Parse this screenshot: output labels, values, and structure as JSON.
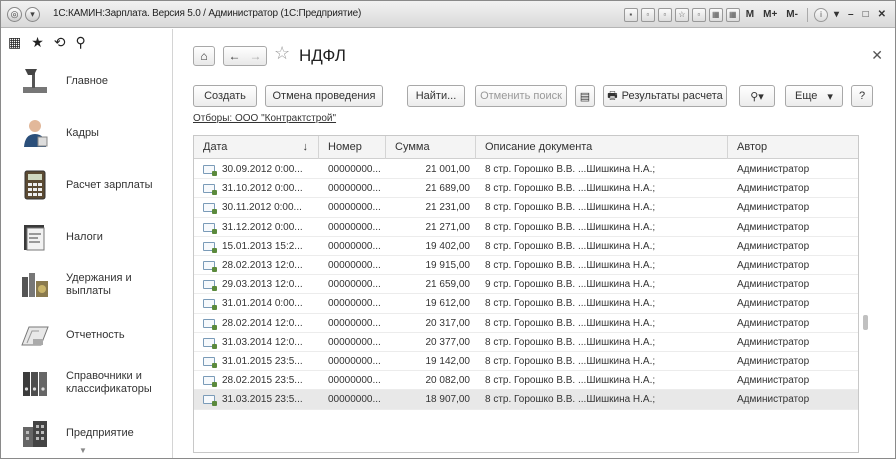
{
  "window": {
    "title": "1С:КАМИН:Зарплата. Версия 5.0 / Администратор (1С:Предприятие)",
    "toolbar_labels": [
      "M",
      "M+",
      "M-"
    ]
  },
  "sidebar": {
    "items": [
      {
        "label": "Главное",
        "icon": "desk-lamp-icon"
      },
      {
        "label": "Кадры",
        "icon": "person-icon"
      },
      {
        "label": "Расчет зарплаты",
        "icon": "calculator-icon"
      },
      {
        "label": "Налоги",
        "icon": "tax-book-icon"
      },
      {
        "label": "Удержания и выплаты",
        "icon": "money-stack-icon"
      },
      {
        "label": "Отчетность",
        "icon": "report-icon"
      },
      {
        "label": "Справочники и классификаторы",
        "icon": "binders-icon"
      },
      {
        "label": "Предприятие",
        "icon": "building-icon"
      }
    ]
  },
  "page": {
    "title": "НДФЛ"
  },
  "toolbar": {
    "create": "Создать",
    "cancel_posting": "Отмена проведения",
    "find": "Найти...",
    "cancel_search": "Отменить поиск",
    "results": "Результаты расчета",
    "more": "Еще",
    "help": "?"
  },
  "filter_text": "Отборы: ООО \"Контрактстрой\"",
  "table": {
    "columns": [
      "Дата",
      "Номер",
      "Сумма",
      "Описание документа",
      "Автор"
    ],
    "sort_indicator": "↓",
    "rows": [
      {
        "date": "30.09.2012 0:00...",
        "number": "00000000...",
        "sum": "21 001,00",
        "desc": "8 стр. Горошко В.В. ...Шишкина Н.А.;",
        "author": "Администратор"
      },
      {
        "date": "31.10.2012 0:00...",
        "number": "00000000...",
        "sum": "21 689,00",
        "desc": "8 стр. Горошко В.В. ...Шишкина Н.А.;",
        "author": "Администратор"
      },
      {
        "date": "30.11.2012 0:00...",
        "number": "00000000...",
        "sum": "21 231,00",
        "desc": "8 стр. Горошко В.В. ...Шишкина Н.А.;",
        "author": "Администратор"
      },
      {
        "date": "31.12.2012 0:00...",
        "number": "00000000...",
        "sum": "21 271,00",
        "desc": "8 стр. Горошко В.В. ...Шишкина Н.А.;",
        "author": "Администратор"
      },
      {
        "date": "15.01.2013 15:2...",
        "number": "00000000...",
        "sum": "19 402,00",
        "desc": "8 стр. Горошко В.В. ...Шишкина Н.А.;",
        "author": "Администратор"
      },
      {
        "date": "28.02.2013 12:0...",
        "number": "00000000...",
        "sum": "19 915,00",
        "desc": "8 стр. Горошко В.В. ...Шишкина Н.А.;",
        "author": "Администратор"
      },
      {
        "date": "29.03.2013 12:0...",
        "number": "00000000...",
        "sum": "21 659,00",
        "desc": "9 стр. Горошко В.В. ...Шишкина Н.А.;",
        "author": "Администратор"
      },
      {
        "date": "31.01.2014 0:00...",
        "number": "00000000...",
        "sum": "19 612,00",
        "desc": "8 стр. Горошко В.В. ...Шишкина Н.А.;",
        "author": "Администратор"
      },
      {
        "date": "28.02.2014 12:0...",
        "number": "00000000...",
        "sum": "20 317,00",
        "desc": "8 стр. Горошко В.В. ...Шишкина Н.А.;",
        "author": "Администратор"
      },
      {
        "date": "31.03.2014 12:0...",
        "number": "00000000...",
        "sum": "20 377,00",
        "desc": "8 стр. Горошко В.В. ...Шишкина Н.А.;",
        "author": "Администратор"
      },
      {
        "date": "31.01.2015 23:5...",
        "number": "00000000...",
        "sum": "19 142,00",
        "desc": "8 стр. Горошко В.В. ...Шишкина Н.А.;",
        "author": "Администратор"
      },
      {
        "date": "28.02.2015 23:5...",
        "number": "00000000...",
        "sum": "20 082,00",
        "desc": "8 стр. Горошко В.В. ...Шишкина Н.А.;",
        "author": "Администратор"
      },
      {
        "date": "31.03.2015 23:5...",
        "number": "00000000...",
        "sum": "18 907,00",
        "desc": "8 стр. Горошко В.В. ...Шишкина Н.А.;",
        "author": "Администратор"
      }
    ],
    "selected_index": 12
  }
}
